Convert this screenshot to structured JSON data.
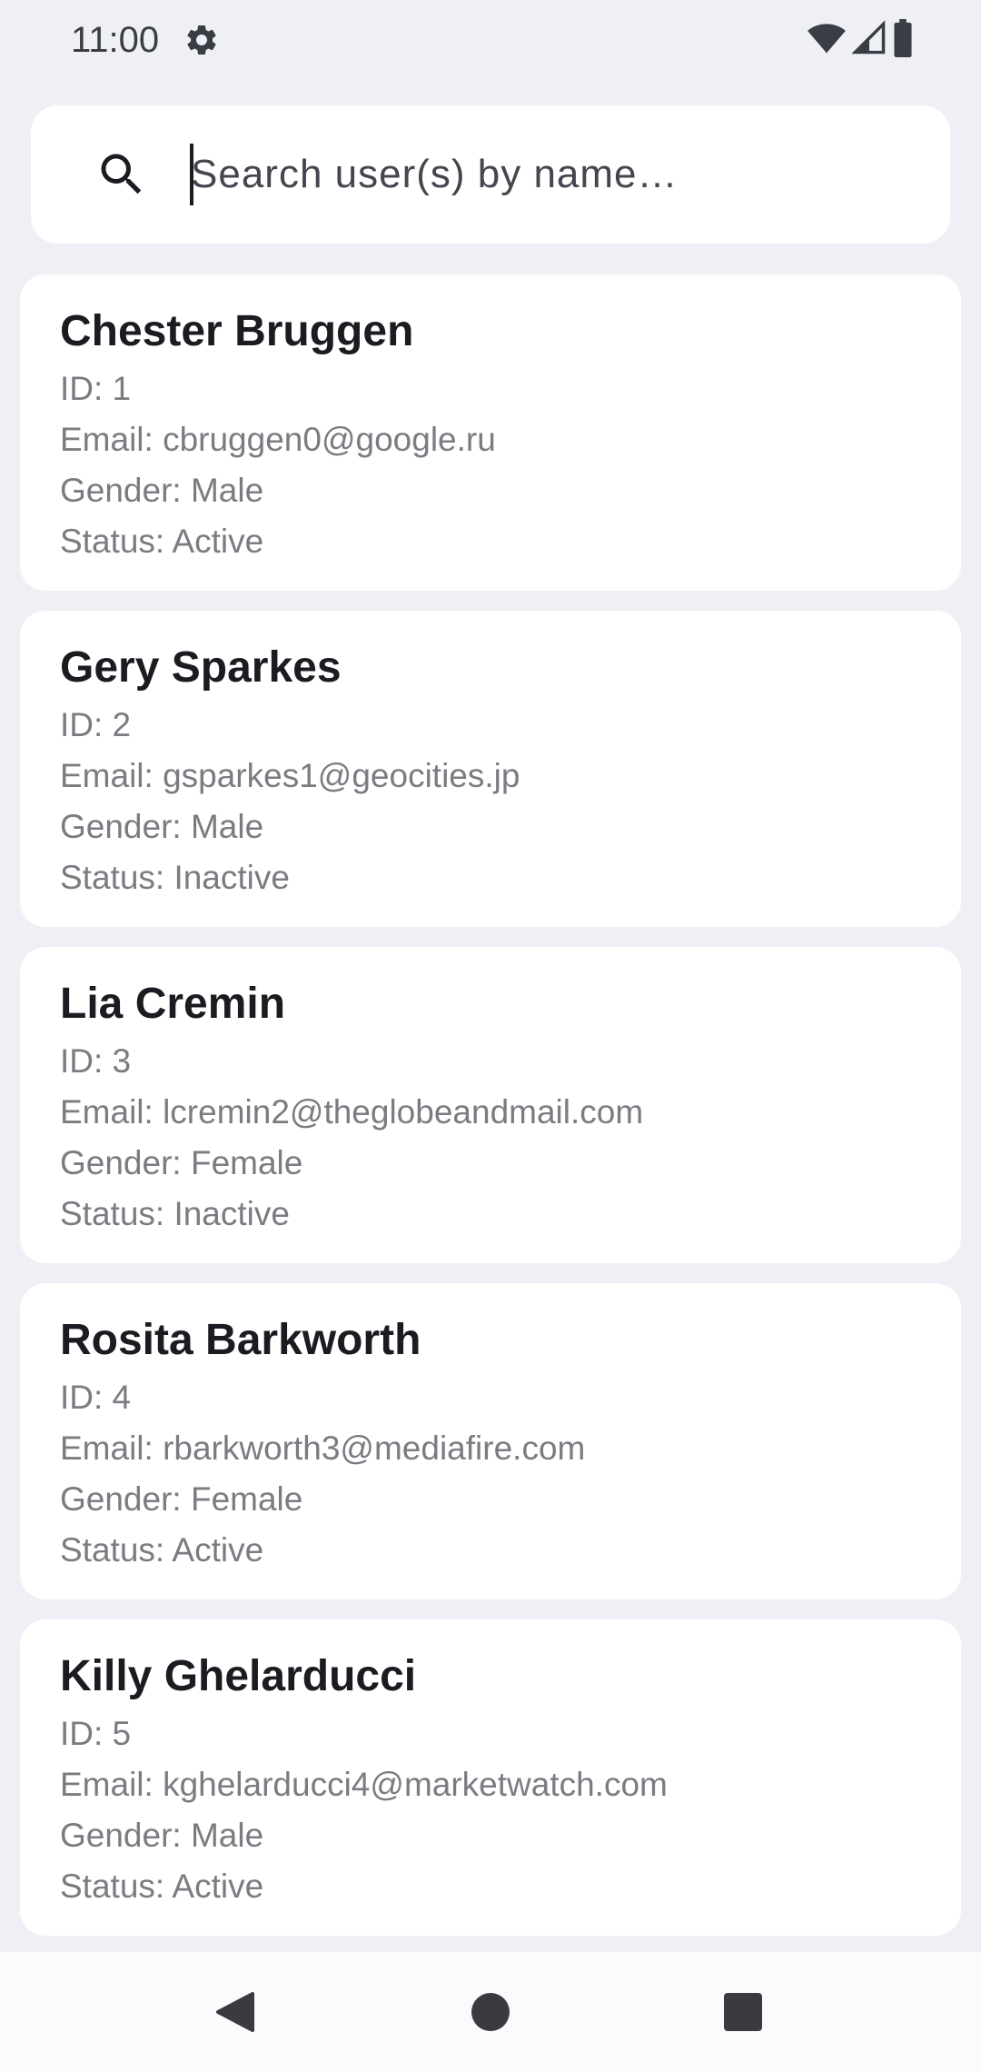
{
  "status_bar": {
    "time": "11:00",
    "icons": [
      "gear-icon",
      "wifi-icon",
      "cellular-signal-icon",
      "battery-icon"
    ]
  },
  "search": {
    "placeholder": "Search user(s) by name…",
    "value": "",
    "icon": "search-icon"
  },
  "users": [
    {
      "name": "Chester Bruggen",
      "id": "ID: 1",
      "email": "Email: cbruggen0@google.ru",
      "gender": "Gender: Male",
      "status": "Status: Active"
    },
    {
      "name": "Gery Sparkes",
      "id": "ID: 2",
      "email": "Email: gsparkes1@geocities.jp",
      "gender": "Gender: Male",
      "status": "Status: Inactive"
    },
    {
      "name": "Lia Cremin",
      "id": "ID: 3",
      "email": "Email: lcremin2@theglobeandmail.com",
      "gender": "Gender: Female",
      "status": "Status: Inactive"
    },
    {
      "name": "Rosita Barkworth",
      "id": "ID: 4",
      "email": "Email: rbarkworth3@mediafire.com",
      "gender": "Gender: Female",
      "status": "Status: Active"
    },
    {
      "name": "Killy Ghelarducci",
      "id": "ID: 5",
      "email": "Email: kghelarducci4@marketwatch.com",
      "gender": "Gender: Male",
      "status": "Status: Active"
    }
  ],
  "nav_bar": {
    "icons": [
      "back-icon",
      "home-icon",
      "recents-icon"
    ]
  },
  "colors": {
    "background": "#eff0f6",
    "card": "#ffffff",
    "title_text": "#1b1c21",
    "detail_text": "#7b7c82"
  }
}
